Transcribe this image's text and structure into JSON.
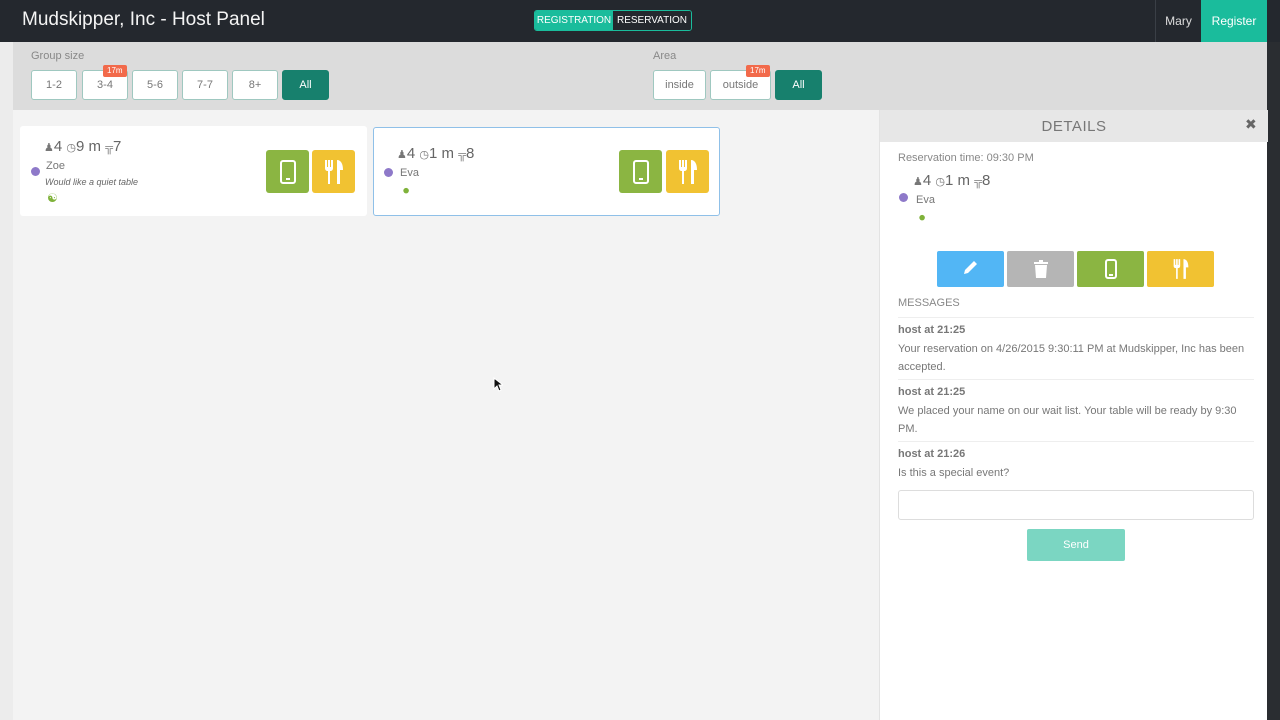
{
  "app": {
    "title": "Mudskipper, Inc - Host Panel"
  },
  "header": {
    "modes": [
      "REGISTRATION",
      "RESERVATION"
    ],
    "user": "Mary",
    "register_label": "Register"
  },
  "filters": {
    "group_size": {
      "label": "Group size",
      "options": [
        "1-2",
        "3-4",
        "5-6",
        "7-7",
        "8+",
        "All"
      ],
      "badge": "17m",
      "selected": "All"
    },
    "area": {
      "label": "Area",
      "options": [
        "inside",
        "outside",
        "All"
      ],
      "badge": "17m",
      "selected": "All"
    }
  },
  "cards": [
    {
      "party": "4",
      "wait": "9 m",
      "table": "7",
      "name": "Zoe",
      "note": "Would like a quiet table",
      "selected": false
    },
    {
      "party": "4",
      "wait": "1 m",
      "table": "8",
      "name": "Eva",
      "note": "",
      "selected": true
    }
  ],
  "details": {
    "title": "DETAILS",
    "reservation_time": "Reservation time: 09:30 PM",
    "party": "4",
    "wait": "1 m",
    "table": "8",
    "name": "Eva",
    "messages_heading": "MESSAGES",
    "messages": [
      {
        "author": "host at 21:25",
        "text": "Your reservation on 4/26/2015 9:30:11 PM at Mudskipper, Inc has been accepted."
      },
      {
        "author": "host at 21:25",
        "text": "We placed your name on our wait list. Your table will be ready by 9:30 PM."
      },
      {
        "author": "host at 21:26",
        "text": "Is this a special event?"
      }
    ],
    "input_value": "",
    "send_label": "Send"
  },
  "colors": {
    "accent": "#1abc9c",
    "filter_active": "#17806d",
    "badge": "#f26a4b",
    "status_dot": "#8e79c9",
    "phone_button": "#8bb542",
    "dine_button": "#f1c232",
    "edit_button": "#52b6f5",
    "delete_button": "#b5b5b5"
  },
  "icons": {
    "party": "person-icon",
    "wait": "clock-icon",
    "table": "table-icon",
    "phone": "phone-icon",
    "dine": "fork-knife-icon",
    "edit": "pencil-icon",
    "delete": "trash-icon",
    "close": "close-icon",
    "child": "child-icon",
    "stroller": "stroller-icon"
  }
}
